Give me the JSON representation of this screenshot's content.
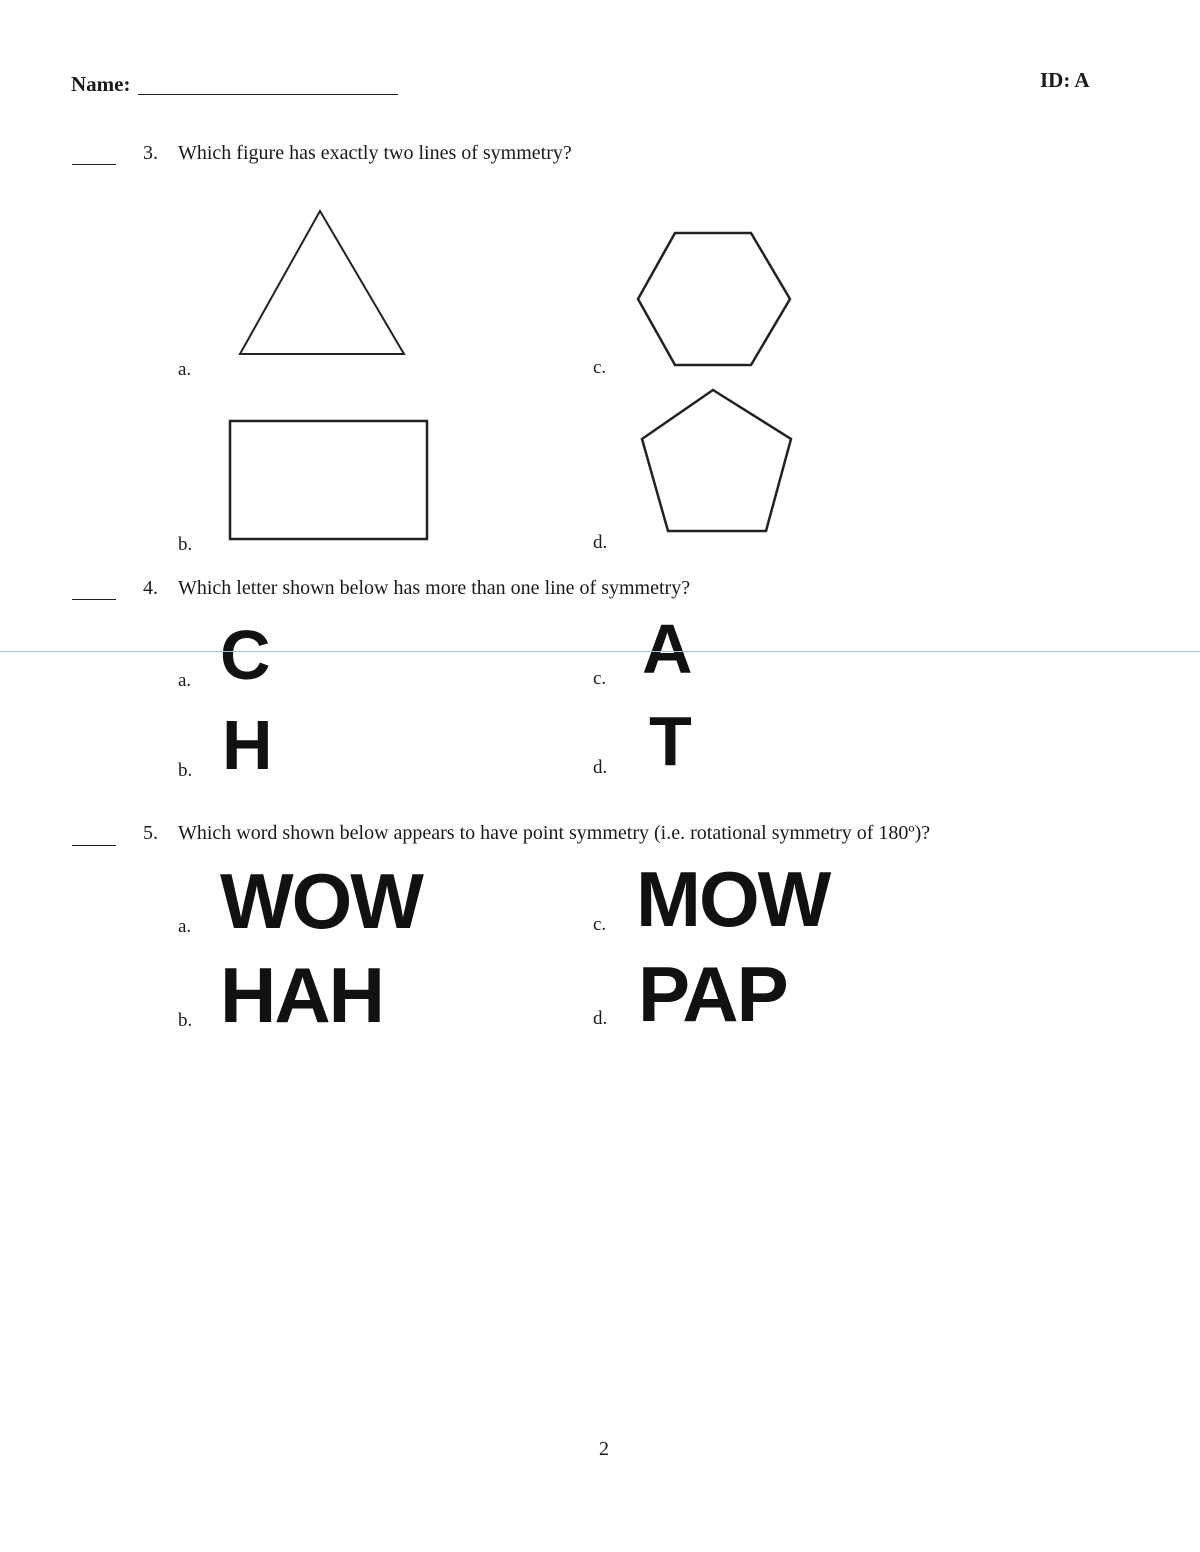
{
  "header": {
    "name_label": "Name:",
    "id_label": "ID: A"
  },
  "questions": [
    {
      "number": "3.",
      "text": "Which figure has exactly two lines of symmetry?",
      "options": [
        {
          "label": "a.",
          "figure": "triangle-shape"
        },
        {
          "label": "b.",
          "figure": "rectangle-shape"
        },
        {
          "label": "c.",
          "figure": "hexagon-shape"
        },
        {
          "label": "d.",
          "figure": "pentagon-shape"
        }
      ]
    },
    {
      "number": "4.",
      "text": "Which letter shown below has more than one line of symmetry?",
      "options": [
        {
          "label": "a.",
          "value": "C"
        },
        {
          "label": "b.",
          "value": "H"
        },
        {
          "label": "c.",
          "value": "A"
        },
        {
          "label": "d.",
          "value": "T"
        }
      ]
    },
    {
      "number": "5.",
      "text": "Which word shown below appears to have point symmetry (i.e. rotational symmetry of 180º)?",
      "options": [
        {
          "label": "a.",
          "value": "WOW"
        },
        {
          "label": "b.",
          "value": "HAH"
        },
        {
          "label": "c.",
          "value": "MOW"
        },
        {
          "label": "d.",
          "value": "PAP"
        }
      ]
    }
  ],
  "footer": {
    "page_number": "2"
  }
}
